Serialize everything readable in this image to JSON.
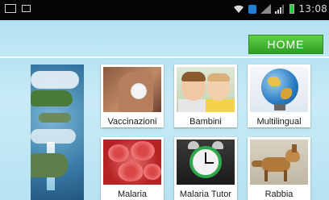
{
  "status_bar": {
    "time": "13:08",
    "icons": [
      "gallery-icon",
      "notification-icon",
      "wifi-icon",
      "sim-indicator-icon",
      "signal-icon",
      "signal-icon",
      "battery-icon"
    ]
  },
  "header": {
    "home_label": "HOME",
    "accent": "#3db32a"
  },
  "tiles": [
    {
      "label": "Vaccinazioni",
      "image": "vaccination-photo"
    },
    {
      "label": "Bambini",
      "image": "children-photo"
    },
    {
      "label": "Multilingual",
      "image": "globe-photo"
    },
    {
      "label": "Malaria",
      "image": "blood-cells-photo"
    },
    {
      "label": "Malaria Tutor",
      "image": "alarm-clock-photo"
    },
    {
      "label": "Rabbia",
      "image": "fox-photo"
    }
  ],
  "background": {
    "color": "#b9e3f1",
    "decoration": "earth-image"
  }
}
